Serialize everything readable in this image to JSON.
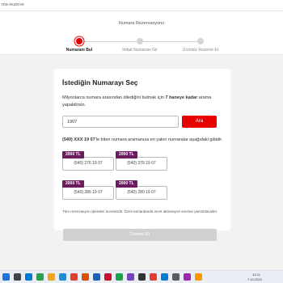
{
  "browser": {
    "address_fragment": "ma-rezerve"
  },
  "header": {
    "title": "Numara Rezervasyonu",
    "steps": [
      {
        "label": "Numaranı Bul",
        "active": true
      },
      {
        "label": "İrtibat Numarası Gir",
        "active": false
      },
      {
        "label": "Ücretsiz Rezerve Et",
        "active": false
      }
    ]
  },
  "card": {
    "title": "İstediğin Numarayı Seç",
    "desc_prefix": "Milyonlarca numara arasından dilediğini bulmak için ",
    "desc_bold": "7 haneye kadar",
    "desc_suffix": " arama yapabilirsin.",
    "search_value": "1907",
    "search_button": "Ara",
    "result_bold": "(540) XXX 19 07",
    "result_rest": "'le biten numara aramanıza en yakın numaralar aşağıdaki gibidir.",
    "options": [
      {
        "price": "2000 TL",
        "number": "(540) 276 19 07"
      },
      {
        "price": "2000 TL",
        "number": "(540) 278 19 07"
      },
      {
        "price": "2000 TL",
        "number": "(540) 286 19 07"
      },
      {
        "price": "2000 TL",
        "number": "(540) 289 19 07"
      }
    ],
    "disclaimer": "Tüm rezervasyon işlemleri ücretsizdir. Özel numaralarda ücret aktivasyon sonrası yansıtılacaktır."
  },
  "continue_button": "Devam Et",
  "taskbar": {
    "time": "14:21",
    "date": "7.10.2024"
  },
  "colors": {
    "accent": "#e60000",
    "badge": "#6b1d60",
    "disabled": "#d0d0d0"
  }
}
